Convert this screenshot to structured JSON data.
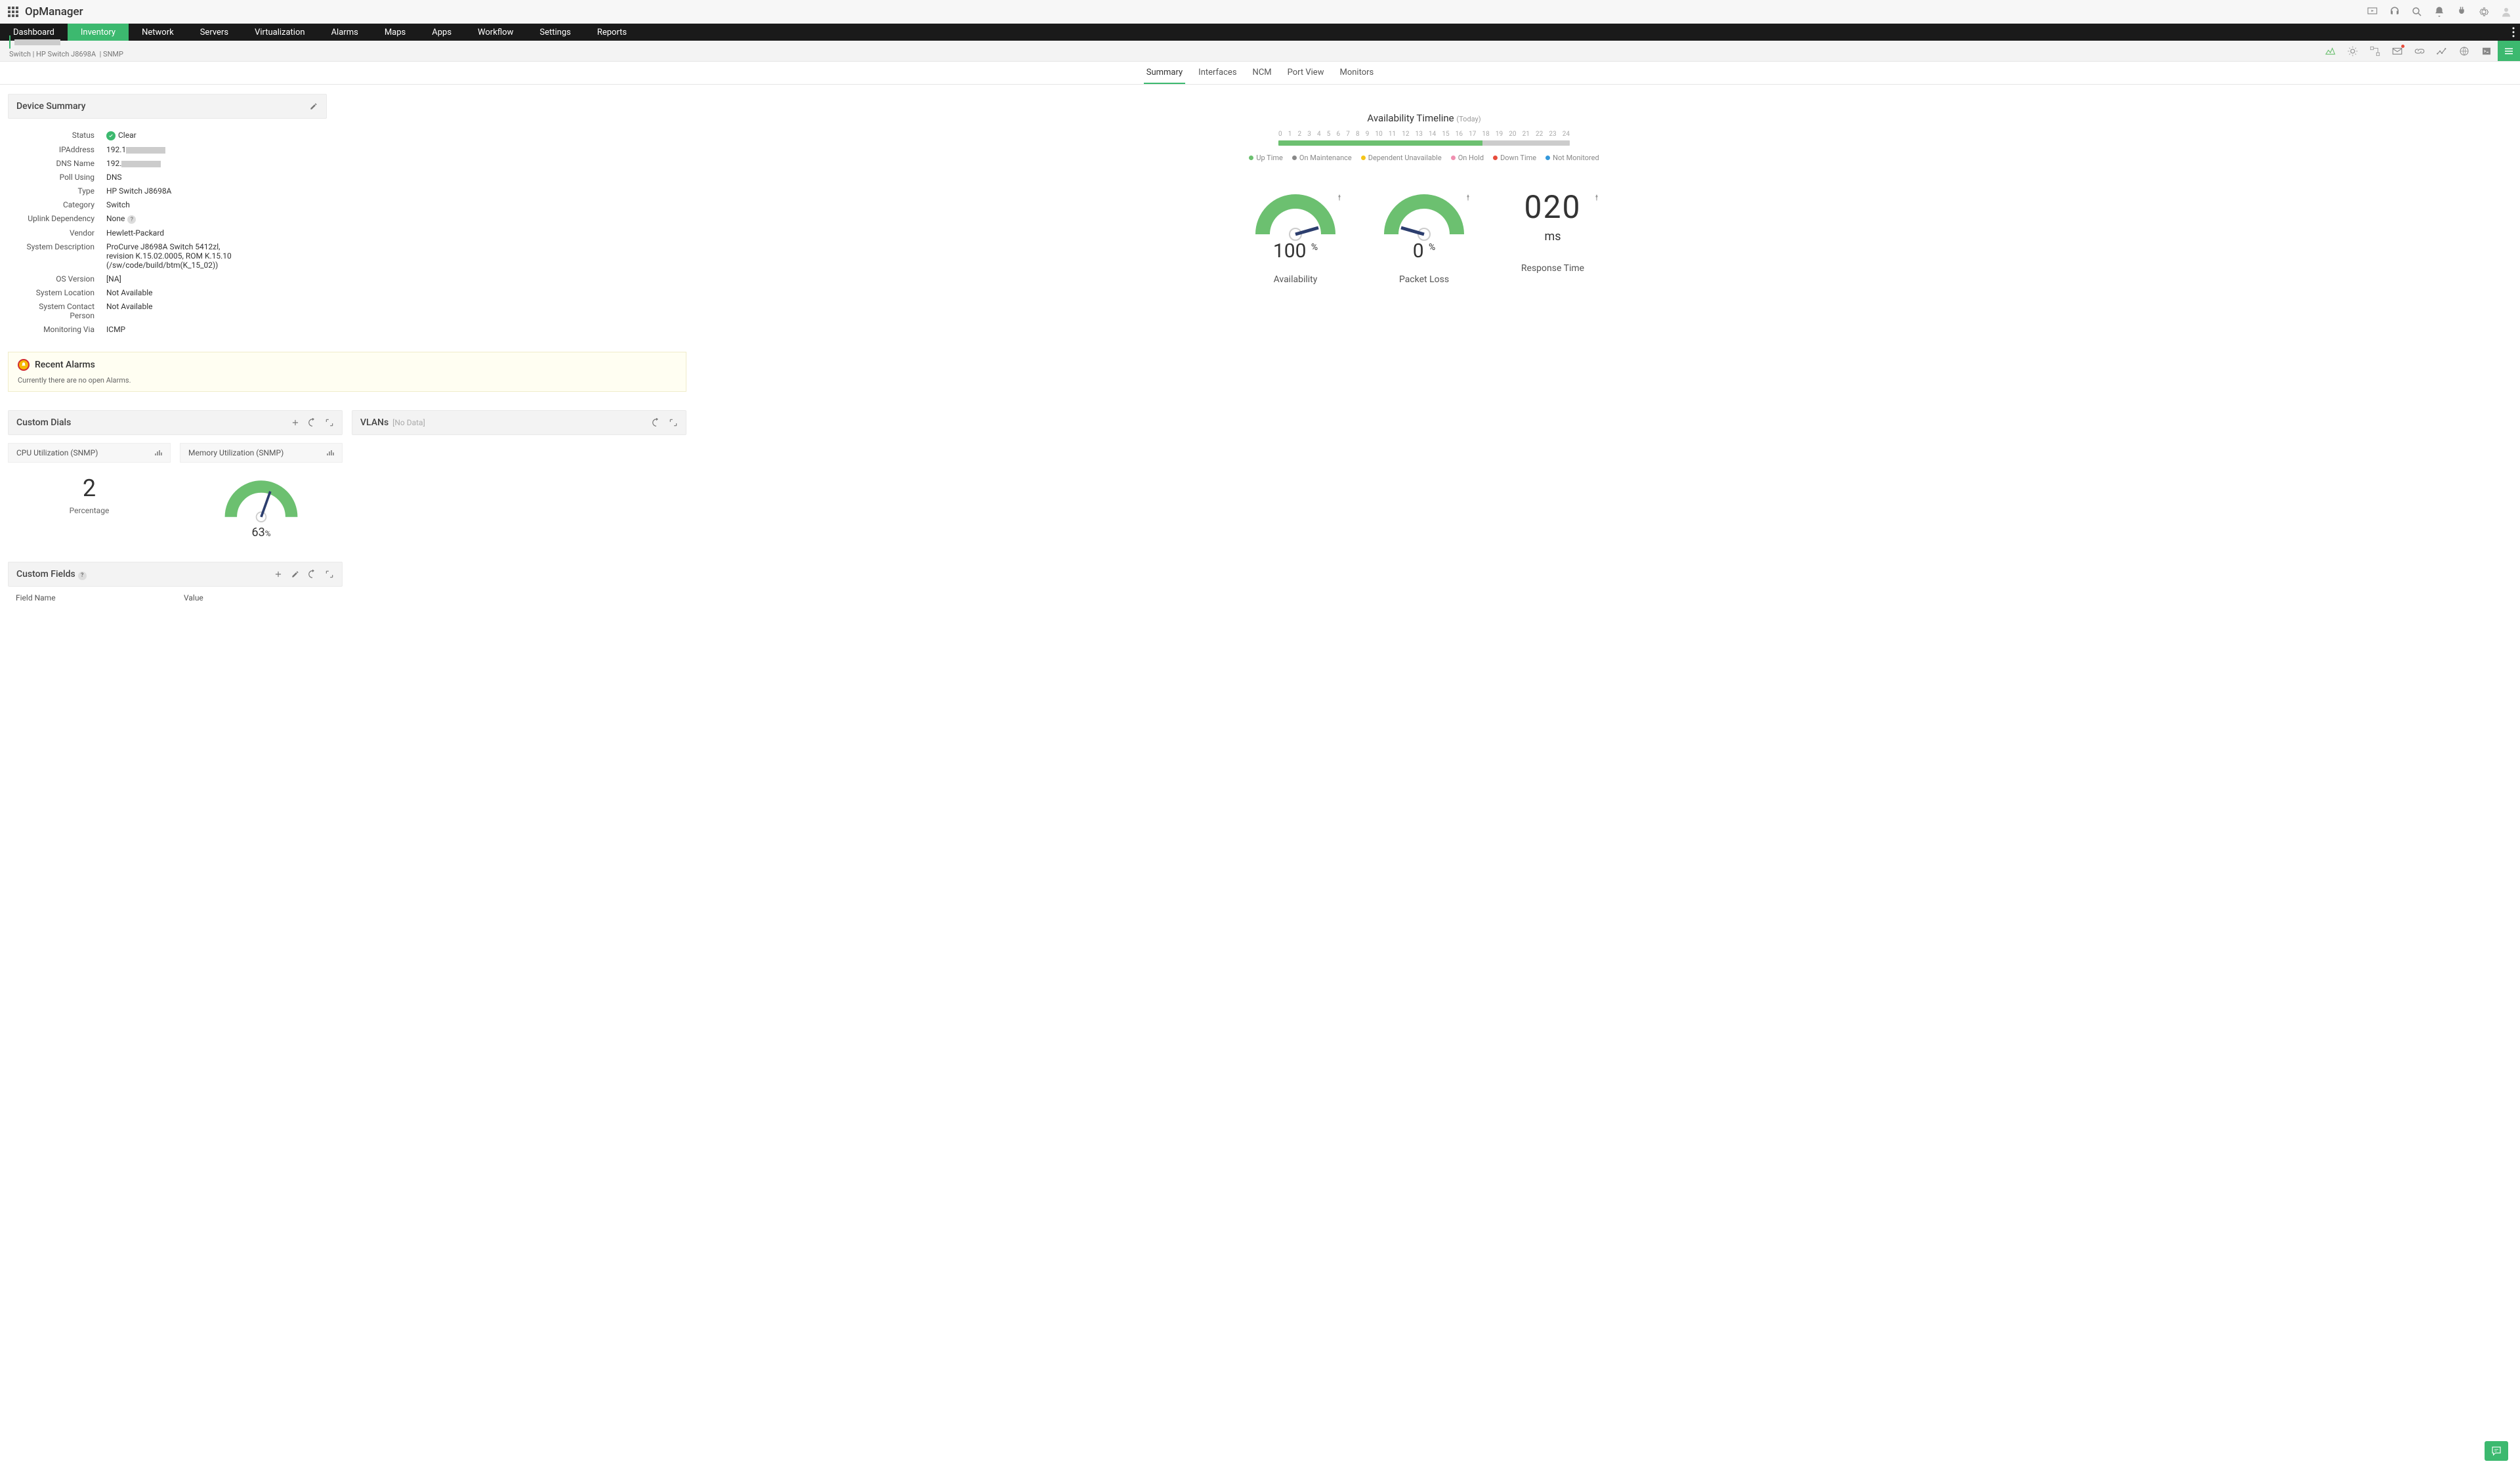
{
  "app": {
    "name": "OpManager"
  },
  "nav": {
    "items": [
      "Dashboard",
      "Inventory",
      "Network",
      "Servers",
      "Virtualization",
      "Alarms",
      "Maps",
      "Apps",
      "Workflow",
      "Settings",
      "Reports"
    ],
    "active": 1
  },
  "breadcrumb": {
    "device_type": "Switch",
    "model": "HP Switch J8698A",
    "protocol": "SNMP"
  },
  "tabs": {
    "items": [
      "Summary",
      "Interfaces",
      "NCM",
      "Port View",
      "Monitors"
    ],
    "active": 0
  },
  "device_summary": {
    "title": "Device Summary",
    "rows": {
      "status_label": "Status",
      "status_value": "Clear",
      "ip_label": "IPAddress",
      "ip_value": "192.1",
      "dns_label": "DNS Name",
      "dns_value": "192.",
      "poll_label": "Poll Using",
      "poll_value": "DNS",
      "type_label": "Type",
      "type_value": "HP Switch J8698A",
      "cat_label": "Category",
      "cat_value": "Switch",
      "uplink_label": "Uplink Dependency",
      "uplink_value": "None",
      "vendor_label": "Vendor",
      "vendor_value": "Hewlett-Packard",
      "desc_label": "System Description",
      "desc_value": "ProCurve J8698A Switch 5412zl, revision K.15.02.0005, ROM K.15.10 (/sw/code/build/btm(K_15_02))",
      "os_label": "OS Version",
      "os_value": "[NA]",
      "loc_label": "System Location",
      "loc_value": "Not Available",
      "contact_label": "System Contact Person",
      "contact_value": "Not Available",
      "mon_label": "Monitoring Via",
      "mon_value": "ICMP"
    }
  },
  "timeline": {
    "title": "Availability Timeline",
    "subtitle": "(Today)",
    "hours": [
      "0",
      "1",
      "2",
      "3",
      "4",
      "5",
      "6",
      "7",
      "8",
      "9",
      "10",
      "11",
      "12",
      "13",
      "14",
      "15",
      "16",
      "17",
      "18",
      "19",
      "20",
      "21",
      "22",
      "23",
      "24"
    ],
    "legend": {
      "up": "Up Time",
      "maint": "On Maintenance",
      "dep": "Dependent Unavailable",
      "hold": "On Hold",
      "down": "Down Time",
      "not": "Not Monitored"
    }
  },
  "gauges": {
    "availability": {
      "value": "100",
      "label": "Availability",
      "unit": "%"
    },
    "packet_loss": {
      "value": "0",
      "label": "Packet Loss",
      "unit": "%"
    },
    "response": {
      "big": "020",
      "unit": "ms",
      "label": "Response Time"
    }
  },
  "alarms": {
    "title": "Recent Alarms",
    "msg": "Currently there are no open Alarms."
  },
  "custom_dials": {
    "title": "Custom Dials",
    "cpu": {
      "name": "CPU Utilization (SNMP)",
      "value": "2",
      "sub": "Percentage"
    },
    "mem": {
      "name": "Memory Utilization (SNMP)",
      "value": "63",
      "unit": "%"
    }
  },
  "vlans": {
    "title": "VLANs",
    "sub": "[No Data]"
  },
  "custom_fields": {
    "title": "Custom Fields",
    "col1": "Field Name",
    "col2": "Value"
  },
  "chart_data": [
    {
      "type": "bar",
      "title": "Availability Timeline (Today)",
      "x": [
        0,
        1,
        2,
        3,
        4,
        5,
        6,
        7,
        8,
        9,
        10,
        11,
        12,
        13,
        14,
        15,
        16,
        17
      ],
      "series": [
        {
          "name": "Up Time",
          "values": [
            1,
            1,
            1,
            1,
            1,
            1,
            1,
            1,
            1,
            1,
            1,
            1,
            1,
            1,
            1,
            1,
            1,
            1
          ]
        }
      ],
      "xlim": [
        0,
        24
      ],
      "ylim": [
        0,
        1
      ],
      "note": "hours 17-24 not yet monitored (grey)"
    },
    {
      "type": "gauge",
      "title": "Availability",
      "value": 100,
      "ylim": [
        0,
        100
      ],
      "unit": "%"
    },
    {
      "type": "gauge",
      "title": "Packet Loss",
      "value": 0,
      "ylim": [
        0,
        100
      ],
      "unit": "%"
    },
    {
      "type": "gauge",
      "title": "Memory Utilization (SNMP)",
      "value": 63,
      "ylim": [
        0,
        100
      ],
      "unit": "%"
    }
  ]
}
